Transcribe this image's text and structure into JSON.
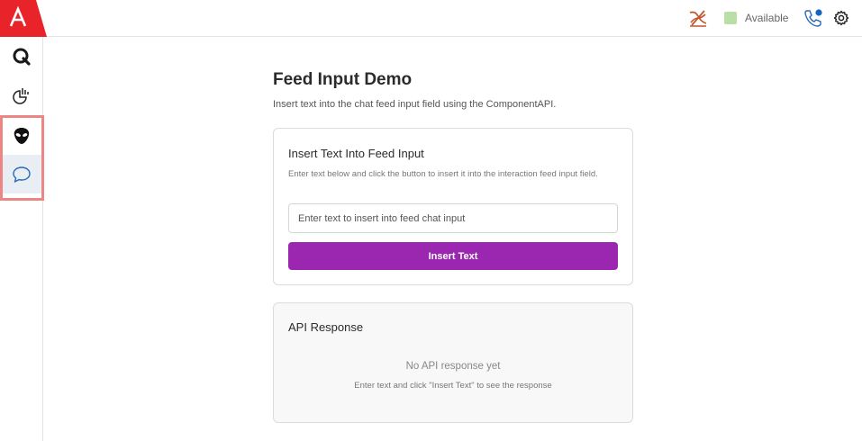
{
  "header": {
    "status_label": "Available",
    "colors": {
      "brand": "#e8232a",
      "status": "#b9dfa6",
      "phone": "#2a6ab0",
      "notification": "#1565c0",
      "mute_icon": "#c0562e"
    },
    "icons": [
      "brand-logo-icon",
      "microphone-off-icon",
      "phone-icon",
      "settings-gear-icon"
    ]
  },
  "sidebar": {
    "items": [
      {
        "icon": "q-letter-icon"
      },
      {
        "icon": "analytics-chart-icon"
      },
      {
        "icon": "alien-icon"
      },
      {
        "icon": "chat-bubble-icon",
        "active": true
      }
    ]
  },
  "page": {
    "title": "Feed Input Demo",
    "description": "Insert text into the chat feed input field using the ComponentAPI."
  },
  "insert_card": {
    "title": "Insert Text Into Feed Input",
    "description": "Enter text below and click the button to insert it into the interaction feed input field.",
    "input_value": "",
    "input_placeholder": "Enter text to insert into feed chat input",
    "button_label": "Insert Text",
    "button_color": "#9b27b0"
  },
  "response_card": {
    "title": "API Response",
    "empty_title": "No API response yet",
    "empty_description": "Enter text and click \"Insert Text\" to see the response"
  }
}
